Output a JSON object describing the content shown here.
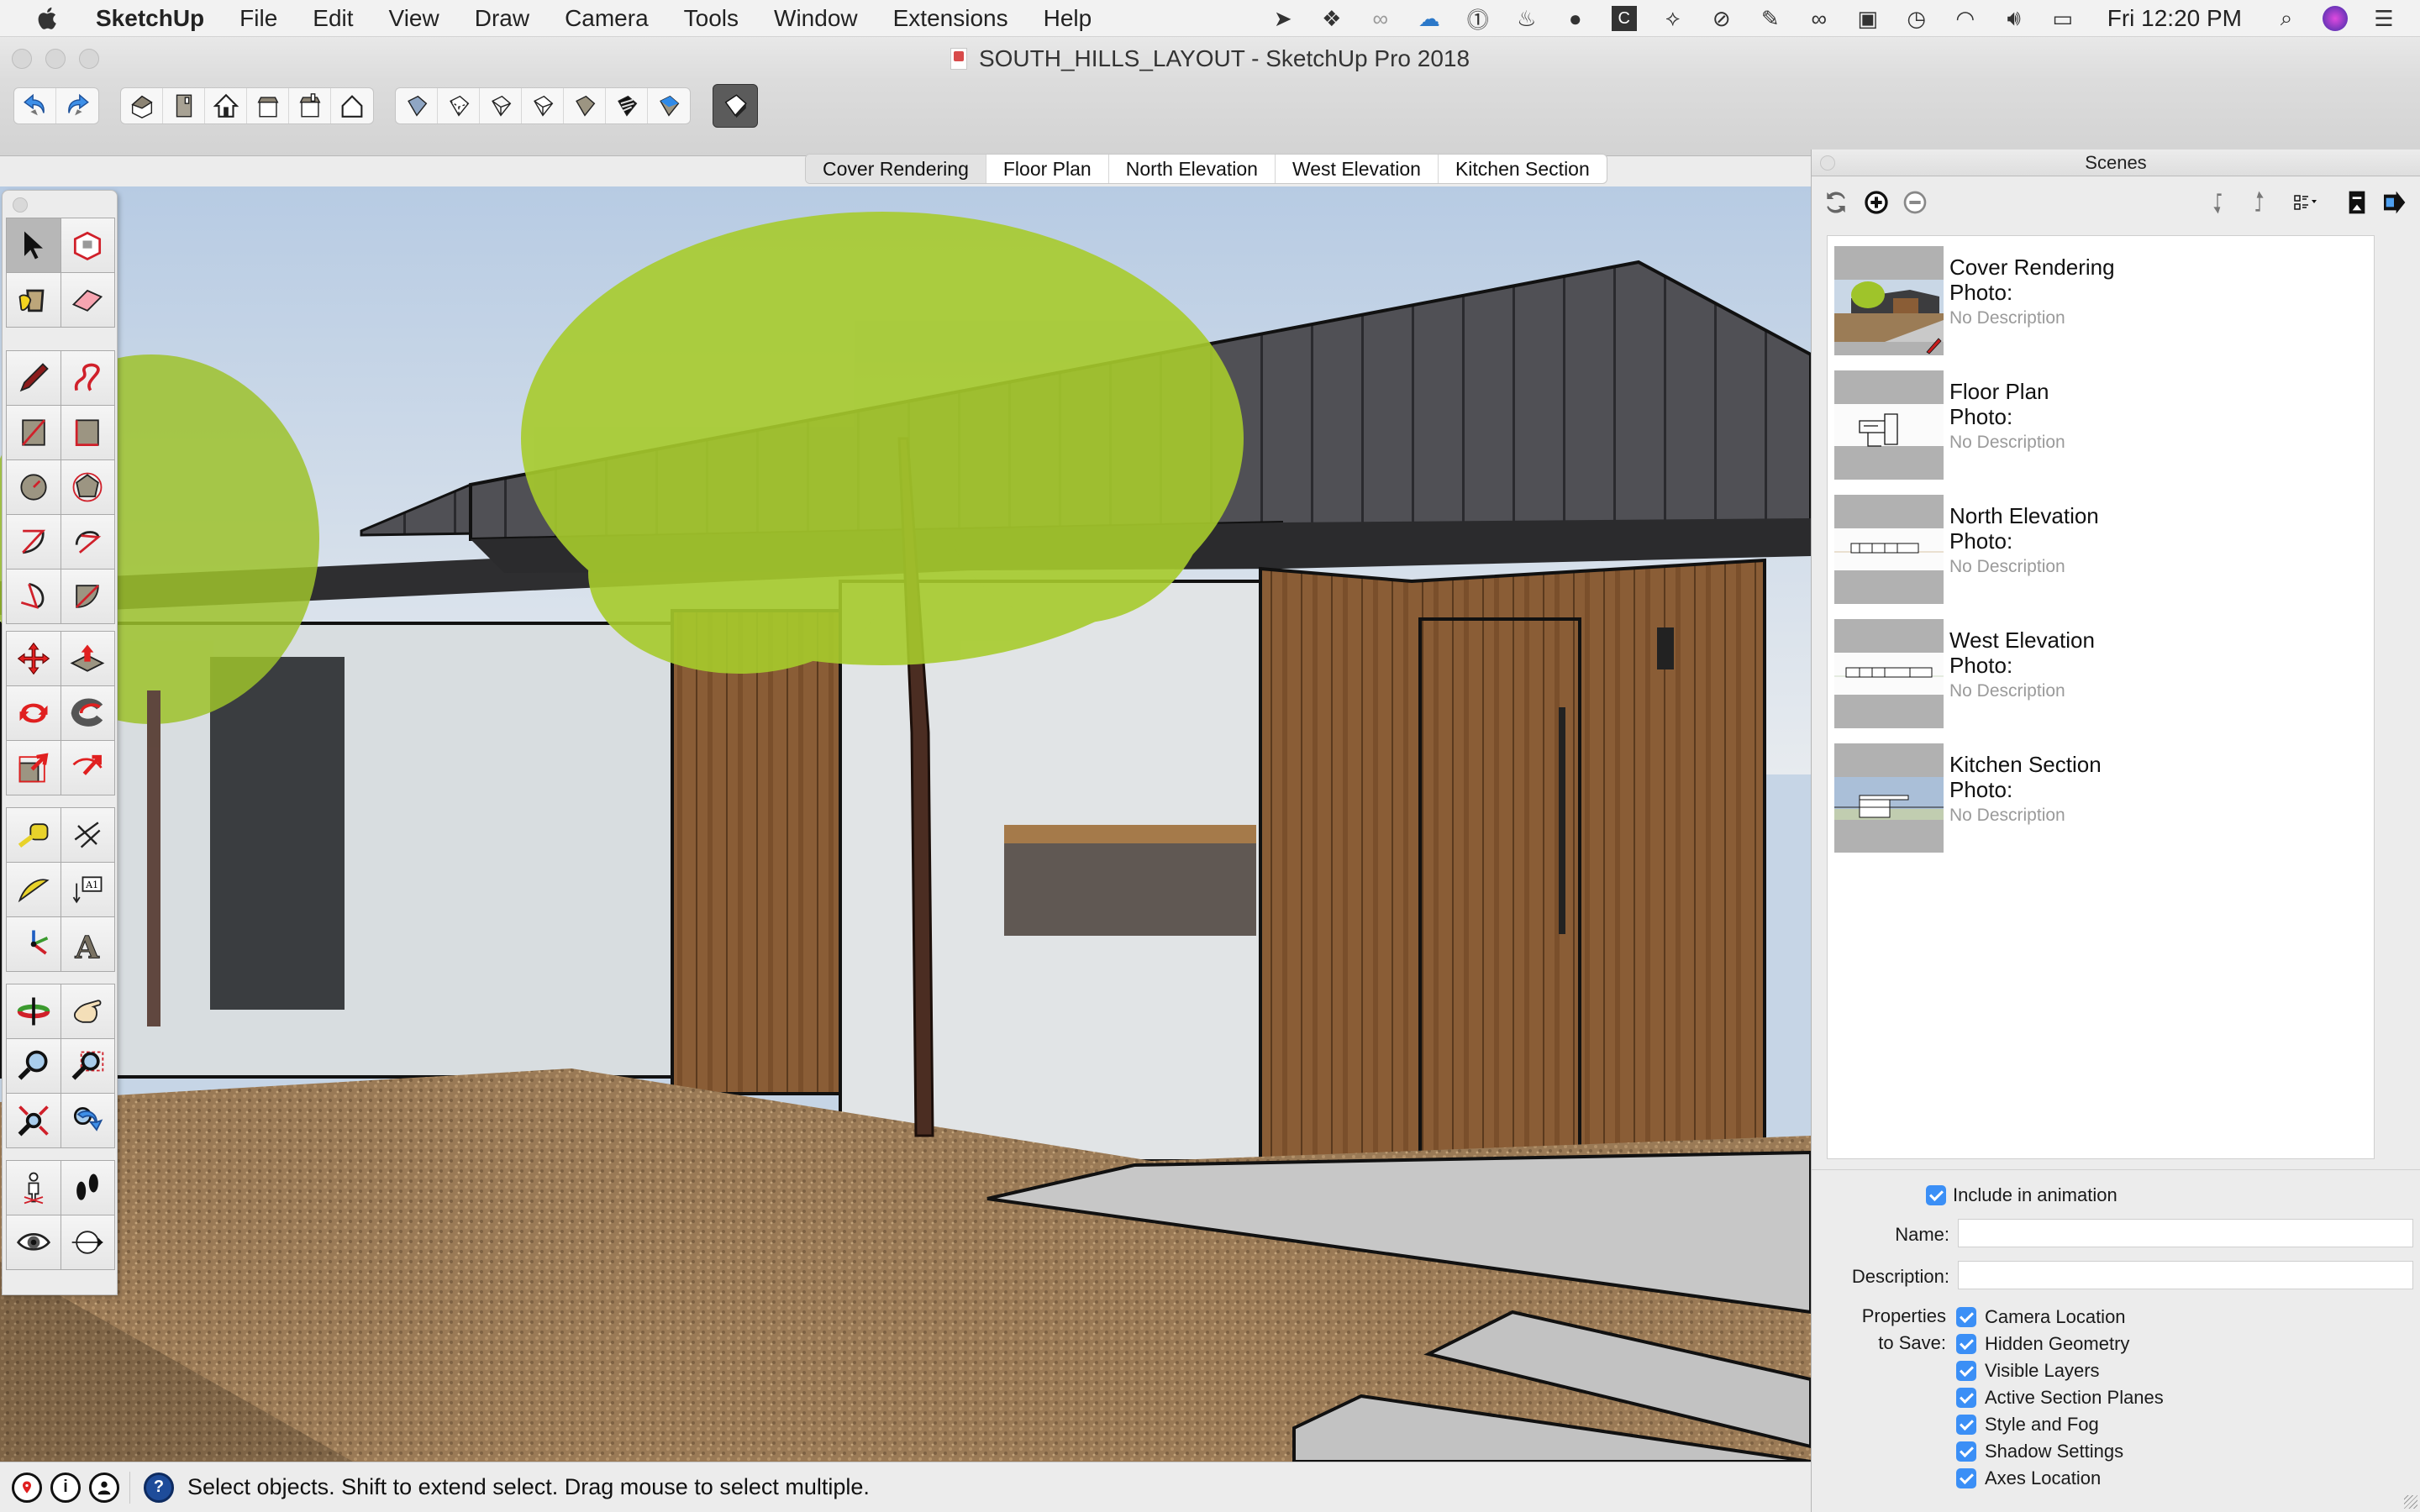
{
  "menubar": {
    "app": "SketchUp",
    "items": [
      "File",
      "Edit",
      "View",
      "Draw",
      "Camera",
      "Tools",
      "Window",
      "Extensions",
      "Help"
    ],
    "status_icons": [
      "location-arrow-icon",
      "dropbox-icon",
      "creative-cloud-icon",
      "cloud-sync-icon",
      "1password-icon",
      "flame-icon",
      "bell-icon",
      "app-c-icon",
      "link-icon",
      "drive-icon",
      "evernote-icon",
      "glasses-icon",
      "record-icon",
      "time-machine-icon",
      "wifi-icon",
      "volume-icon",
      "battery-icon"
    ],
    "clock": "Fri 12:20 PM"
  },
  "window": {
    "title": "SOUTH_HILLS_LAYOUT - SketchUp Pro 2018"
  },
  "toolbar": {
    "groups": [
      [
        "undo",
        "redo"
      ],
      [
        "iso-view",
        "top-view",
        "front-view",
        "right-view",
        "back-view",
        "left-view"
      ],
      [
        "xray-style",
        "back-edges-style",
        "wireframe-style",
        "hidden-line-style",
        "shaded-style",
        "shaded-textures-style",
        "monochrome-style"
      ],
      [
        "default-tray"
      ]
    ]
  },
  "scene_tabs": [
    {
      "label": "Cover Rendering",
      "active": true
    },
    {
      "label": "Floor Plan",
      "active": false
    },
    {
      "label": "North Elevation",
      "active": false
    },
    {
      "label": "West Elevation",
      "active": false
    },
    {
      "label": "Kitchen Section",
      "active": false
    }
  ],
  "palette": {
    "groups": [
      [
        "select",
        "make-component",
        "paint-bucket",
        "eraser"
      ],
      [
        "line",
        "freehand",
        "rectangle",
        "rotated-rectangle",
        "circle",
        "polygon",
        "arc",
        "2-point-arc",
        "3-point-arc",
        "pie"
      ],
      [
        "move",
        "push-pull",
        "rotate",
        "follow-me",
        "scale",
        "offset"
      ],
      [
        "tape-measure",
        "dimension",
        "protractor",
        "text",
        "axes",
        "3d-text"
      ],
      [
        "orbit",
        "pan",
        "zoom",
        "zoom-window",
        "zoom-extents",
        "previous-view"
      ],
      [
        "position-camera",
        "walk",
        "look-around",
        "section-plane"
      ]
    ],
    "selected": "select"
  },
  "status": {
    "text": "Select objects. Shift to extend select. Drag mouse to select multiple."
  },
  "scenes_panel": {
    "title": "Scenes",
    "scenes": [
      {
        "name": "Cover Rendering",
        "photo": "Photo:",
        "description": "No Description"
      },
      {
        "name": "Floor Plan",
        "photo": "Photo:",
        "description": "No Description"
      },
      {
        "name": "North Elevation",
        "photo": "Photo:",
        "description": "No Description"
      },
      {
        "name": "West Elevation",
        "photo": "Photo:",
        "description": "No Description"
      },
      {
        "name": "Kitchen Section",
        "photo": "Photo:",
        "description": "No Description"
      }
    ],
    "include_in_animation": {
      "label": "Include in animation",
      "checked": true
    },
    "name_label": "Name:",
    "name_value": "",
    "description_label": "Description:",
    "description_value": "",
    "properties_label_1": "Properties",
    "properties_label_2": "to Save:",
    "properties": [
      {
        "label": "Camera Location",
        "checked": true
      },
      {
        "label": "Hidden Geometry",
        "checked": true
      },
      {
        "label": "Visible Layers",
        "checked": true
      },
      {
        "label": "Active Section Planes",
        "checked": true
      },
      {
        "label": "Style and Fog",
        "checked": true
      },
      {
        "label": "Shadow Settings",
        "checked": true
      },
      {
        "label": "Axes Location",
        "checked": true
      }
    ]
  },
  "colors": {
    "accent": "#3b8ff6",
    "sky": "#c6d5e6",
    "roof": "#4a4a4e",
    "timber": "#7a5230",
    "gravel": "#9a7a56",
    "concrete": "#c9c9c9",
    "foliage": "#9fc42a"
  }
}
